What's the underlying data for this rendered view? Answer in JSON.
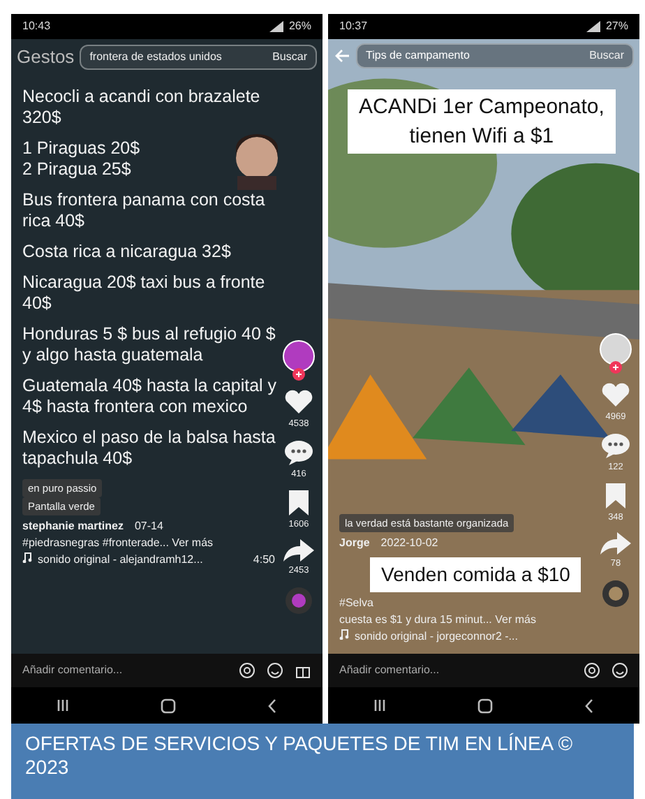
{
  "screens": [
    {
      "kind": "text",
      "status": {
        "time": "10:43",
        "battery": "26%"
      },
      "back_label": "Gestos",
      "search": {
        "value": "frontera de estados unidos",
        "button": "Buscar"
      },
      "paragraphs": [
        "Necocli a acandi con brazalete 320$",
        "1 Piraguas 20$\n2 Piragua 25$",
        "Bus frontera panama con  costa rica 40$",
        "Costa rica a  nicaragua 32$",
        "Nicaragua 20$ taxi bus a fronte 40$",
        "Honduras 5 $ bus al refugio 40 $ y algo hasta guatemala",
        "Guatemala 40$ hasta la capital y 4$ hasta frontera con mexico",
        "Mexico el paso de la balsa hasta tapachula 40$"
      ],
      "labels": [
        "en puro passio",
        "Pantalla verde"
      ],
      "author": "stephanie martinez",
      "date": "07-14",
      "description": "#piedrasnegras #fronterade... Ver más",
      "sound": "sonido original - alejandramh12...",
      "clock": "4:50",
      "counts": [
        "4538",
        "416",
        "1606",
        "2453"
      ],
      "comment_placeholder": "Añadir comentario...",
      "gift": true
    },
    {
      "status": {
        "time": "10:37",
        "battery": "27%"
      },
      "search": {
        "placeholder": "Tips de campamento",
        "button": "Buscar"
      },
      "banners": [
        "ACANDi 1er Campeonato,\ntienen Wifi a $1",
        "Venden comida a $10"
      ],
      "labels": [
        "la verdad está bastante organizada"
      ],
      "author": "Jorge",
      "date": "2022-10-02",
      "description": "#Selva\ncuesta es $1 y dura 15 minut... Ver más",
      "sound": "sonido original - jorgeconnor2 -...",
      "counts": [
        "4969",
        "122",
        "348",
        "78"
      ],
      "comment_placeholder": "Añadir comentario...",
      "gift": false
    }
  ],
  "caption": "OFERTAS DE SERVICIOS Y PAQUETES DE TIM EN LÍNEA © 2023"
}
